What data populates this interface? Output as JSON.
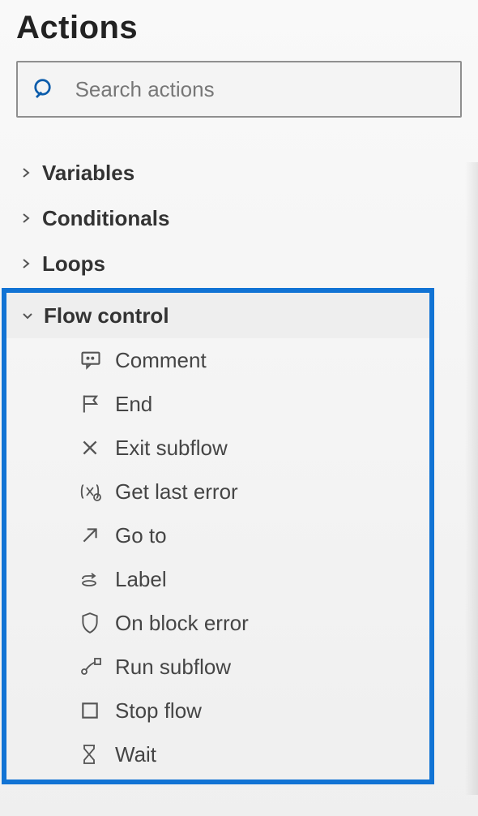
{
  "panel": {
    "title": "Actions",
    "search_placeholder": "Search actions"
  },
  "categories": [
    {
      "label": "Variables",
      "expanded": false
    },
    {
      "label": "Conditionals",
      "expanded": false
    },
    {
      "label": "Loops",
      "expanded": false
    },
    {
      "label": "Flow control",
      "expanded": true
    }
  ],
  "flow_control_actions": [
    {
      "icon": "comment-icon",
      "label": "Comment"
    },
    {
      "icon": "flag-icon",
      "label": "End"
    },
    {
      "icon": "x-icon",
      "label": "Exit subflow"
    },
    {
      "icon": "variable-error-icon",
      "label": "Get last error"
    },
    {
      "icon": "arrow-up-right-icon",
      "label": "Go to"
    },
    {
      "icon": "label-icon",
      "label": "Label"
    },
    {
      "icon": "shield-icon",
      "label": "On block error"
    },
    {
      "icon": "subflow-icon",
      "label": "Run subflow"
    },
    {
      "icon": "stop-square-icon",
      "label": "Stop flow"
    },
    {
      "icon": "hourglass-icon",
      "label": "Wait"
    }
  ],
  "colors": {
    "highlight_border": "#1173d4",
    "search_icon": "#0b5cab"
  }
}
